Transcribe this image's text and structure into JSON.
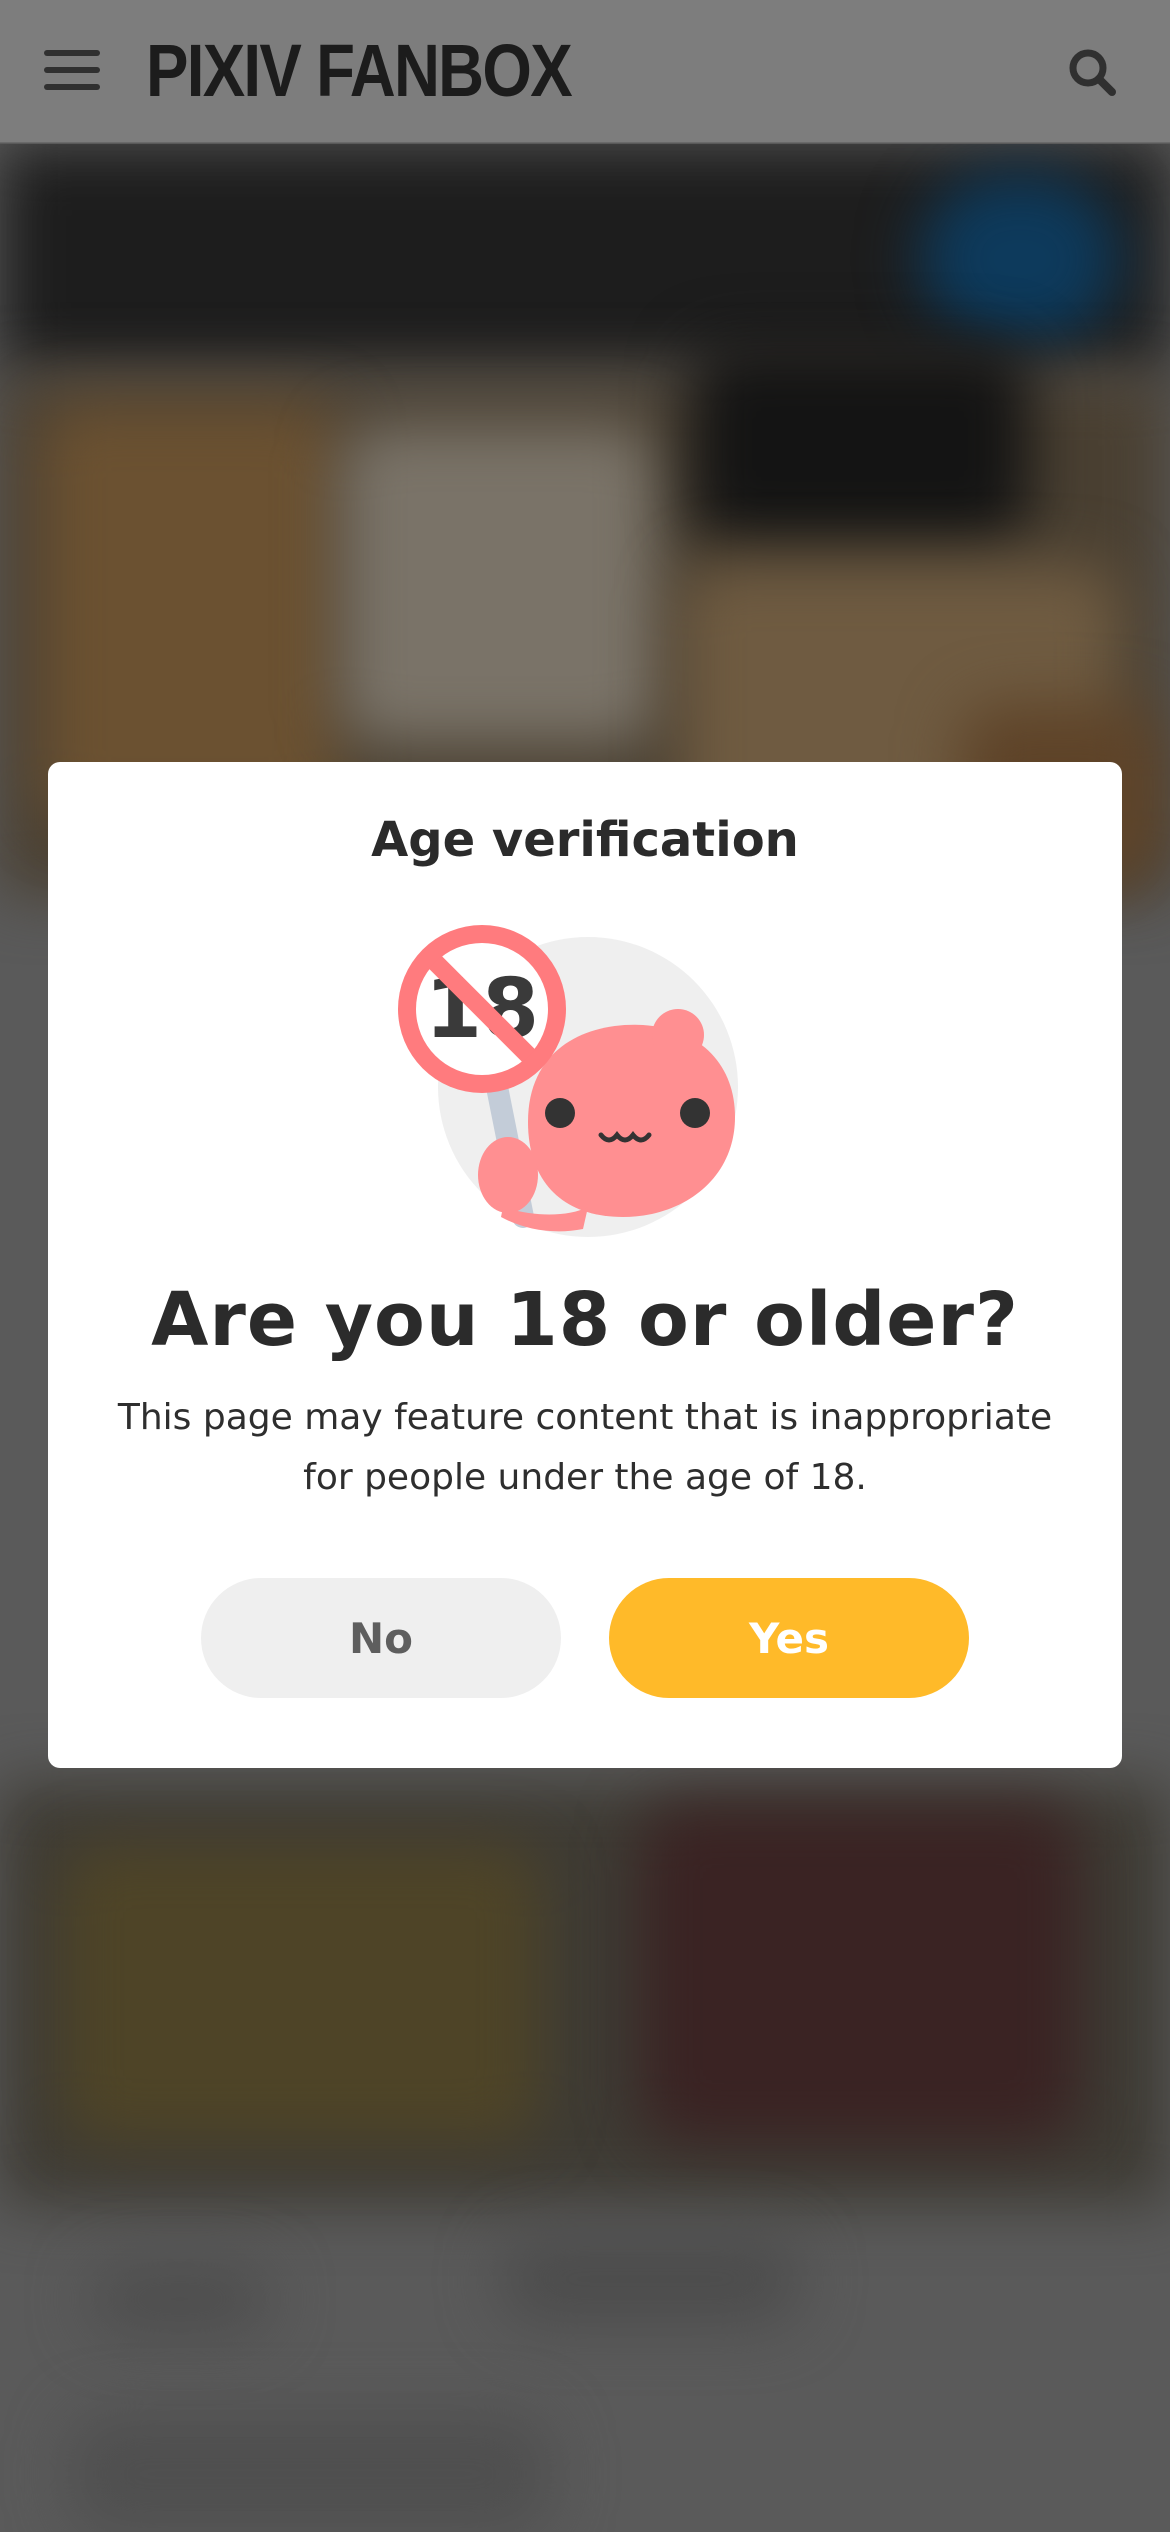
{
  "header": {
    "logo_text": "PIXIV FANBOX",
    "menu_icon": "hamburger-menu-icon",
    "search_icon": "search-icon"
  },
  "modal": {
    "title": "Age verification",
    "illustration": "no-under-18-mascot-icon",
    "question": "Are you 18 or older?",
    "description": "This page may feature content that is inappropriate for people under the age of 18.",
    "no_label": "No",
    "yes_label": "Yes",
    "sign_text": "18"
  },
  "colors": {
    "overlay_bg": "#5a5a5a",
    "header_bg": "#7d7d7d",
    "yes_button": "#ffba29",
    "no_button": "#efefef",
    "mascot_pink": "#ff8f91"
  }
}
